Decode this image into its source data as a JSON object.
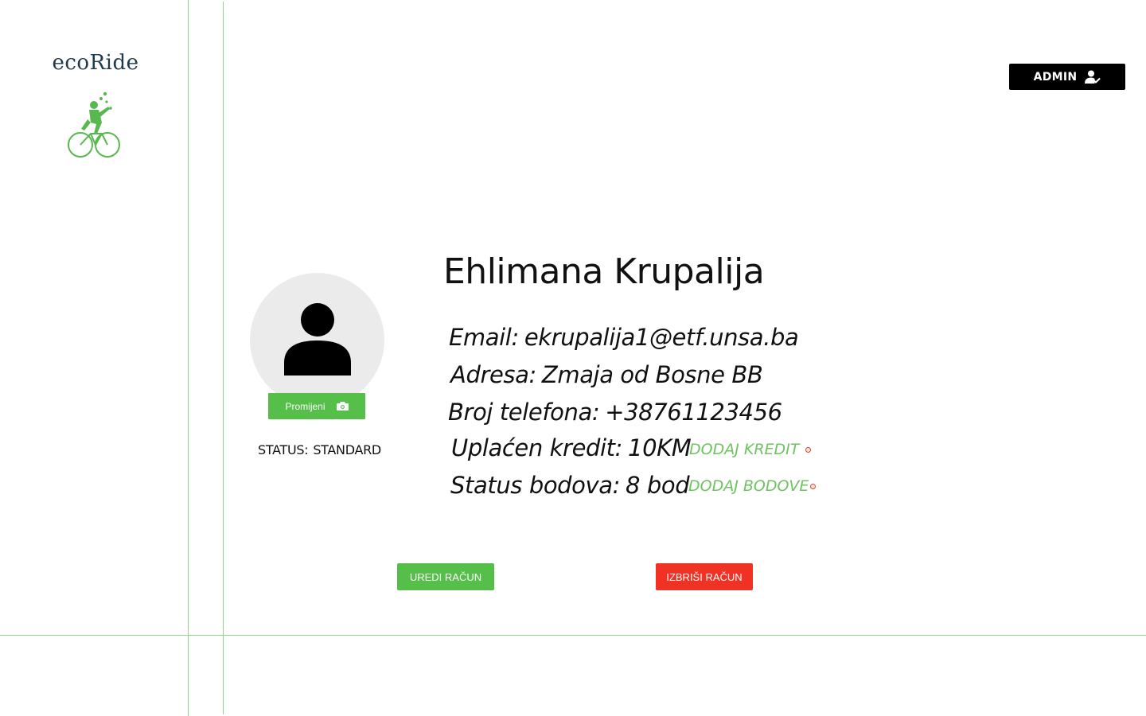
{
  "brand": {
    "name": "ecoRide"
  },
  "header": {
    "admin_label": "ADMIN"
  },
  "profile": {
    "name": "Ehlimana Krupalija",
    "change_photo_label": "Promijeni",
    "status_label": "STATUS:",
    "status_value": "STANDARD",
    "email_label": "Email:",
    "email": "ekrupalija1@etf.unsa.ba",
    "address_label": "Adresa:",
    "address": "Zmaja od Bosne BB",
    "phone_label": "Broj telefona:",
    "phone": "+38761123456",
    "credit_label": "Uplaćen kredit:",
    "credit": "10KM",
    "add_credit_label": "DODAJ KREDIT",
    "points_label": "Status bodova:",
    "points": "8 bod",
    "add_points_label": "DODAJ BODOVE"
  },
  "actions": {
    "edit_label": "UREDI RAČUN",
    "delete_label": "IZBRIŠI RAČUN"
  },
  "colors": {
    "accent_green": "#55bf4a",
    "danger_red": "#ef3223",
    "line_green": "#8fd38f"
  }
}
